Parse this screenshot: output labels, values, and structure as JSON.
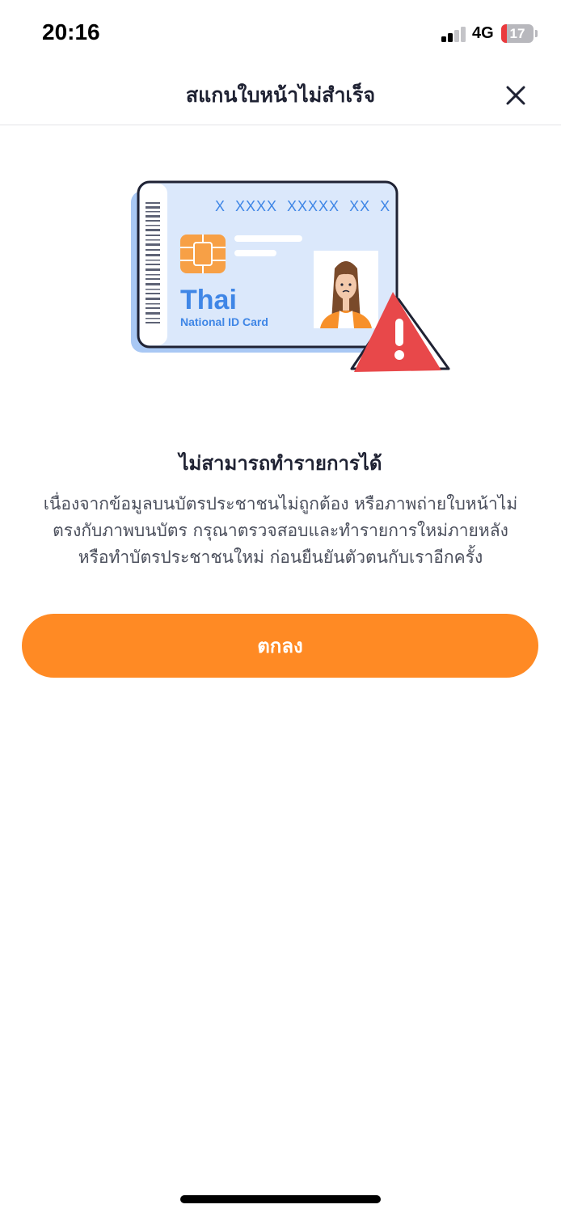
{
  "status_bar": {
    "time": "20:16",
    "network": "4G",
    "battery_level": "17",
    "icons": [
      "signal-bars-icon",
      "battery-icon"
    ]
  },
  "header": {
    "title": "สแกนใบหน้าไม่สำเร็จ",
    "close_icon": "close-icon"
  },
  "illustration": {
    "card_number": "X  XXXX  XXXXX  XX  X",
    "card_title": "Thai",
    "card_subtitle": "National ID Card",
    "icons": [
      "id-card-icon",
      "chip-icon",
      "person-photo-icon",
      "warning-icon"
    ]
  },
  "message": {
    "title": "ไม่สามารถทำรายการได้",
    "body_lines": [
      "เนื่องจากข้อมูลบนบัตรประชาชนไม่ถูกต้อง หรือภาพถ่ายใบหน้าไม่",
      "ตรงกับภาพบนบัตร กรุณาตรวจสอบและทำรายการใหม่ภายหลัง",
      "หรือทำบัตรประชาชนใหม่ ก่อนยืนยันตัวตนกับเราอีกครั้ง"
    ]
  },
  "actions": {
    "ok_label": "ตกลง"
  },
  "colors": {
    "primary": "#ff8a24",
    "card_bg": "#dbe8fb",
    "card_accent": "#3f86e6",
    "warning": "#e8484a",
    "text_dark": "#1f2233",
    "text_body": "#4b4f5c"
  }
}
